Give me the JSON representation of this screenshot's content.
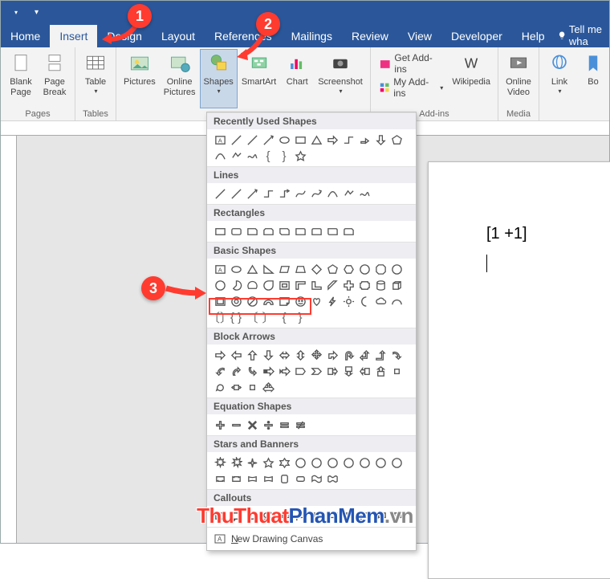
{
  "titlebar": {
    "save_icon": "save-icon",
    "undo_icon": "undo-icon",
    "redo_icon": "redo-icon"
  },
  "tabs": {
    "items": [
      {
        "label": "Home"
      },
      {
        "label": "Insert"
      },
      {
        "label": "Design"
      },
      {
        "label": "Layout"
      },
      {
        "label": "References"
      },
      {
        "label": "Mailings"
      },
      {
        "label": "Review"
      },
      {
        "label": "View"
      },
      {
        "label": "Developer"
      },
      {
        "label": "Help"
      }
    ],
    "tellme": "Tell me wha"
  },
  "ribbon": {
    "groups": {
      "pages": {
        "label": "Pages",
        "blank_page": "Blank\nPage",
        "page_break": "Page\nBreak"
      },
      "tables": {
        "label": "Tables",
        "table": "Table"
      },
      "illustrations": {
        "pictures": "Pictures",
        "online_pictures": "Online\nPictures",
        "shapes": "Shapes",
        "smartart": "SmartArt",
        "chart": "Chart",
        "screenshot": "Screenshot"
      },
      "addins": {
        "label": "Add-ins",
        "get": "Get Add-ins",
        "my": "My Add-ins",
        "wikipedia": "Wikipedia"
      },
      "media": {
        "label": "Media",
        "online_video": "Online\nVideo"
      },
      "links": {
        "link": "Link",
        "bo": "Bo"
      }
    }
  },
  "shapes_dropdown": {
    "sections": {
      "recent": "Recently Used Shapes",
      "lines": "Lines",
      "rectangles": "Rectangles",
      "basic": "Basic Shapes",
      "block": "Block Arrows",
      "equation": "Equation Shapes",
      "stars": "Stars and Banners",
      "callouts": "Callouts"
    },
    "new_canvas": "New Drawing Canvas"
  },
  "document": {
    "text": "[1 +1]"
  },
  "callouts": {
    "c1": "1",
    "c2": "2",
    "c3": "3"
  },
  "watermark": {
    "part1": "ThuThuat",
    "part2": "PhanMem",
    "part3": ".vn"
  }
}
